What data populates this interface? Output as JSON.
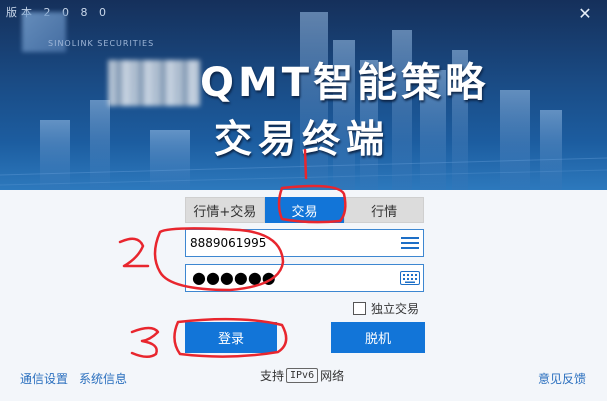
{
  "header": {
    "version_label": "版本 2 0 8 0",
    "logo_subtitle": "SINOLINK SECURITIES",
    "title_line1": "QMT智能策略",
    "title_line2": "交易终端"
  },
  "tabs": [
    {
      "label": "行情+交易",
      "active": false
    },
    {
      "label": "交易",
      "active": true
    },
    {
      "label": "行情",
      "active": false
    }
  ],
  "login": {
    "account_value": "8889061995",
    "password_mask": "●●●●●●",
    "standalone_trade_label": "独立交易",
    "standalone_trade_checked": false,
    "login_button": "登录",
    "offline_button": "脱机"
  },
  "footer": {
    "network_settings": "通信设置",
    "system_info": "系统信息",
    "ipv6_prefix": "支持",
    "ipv6_badge": "IPv6",
    "ipv6_suffix": "网络",
    "feedback": "意见反馈"
  },
  "icons": {
    "menu": "menu-icon",
    "keyboard": "keyboard-icon",
    "close": "close-icon"
  },
  "colors": {
    "accent": "#1275d8",
    "annotation": "#e8262e",
    "link": "#2a6fbe"
  }
}
